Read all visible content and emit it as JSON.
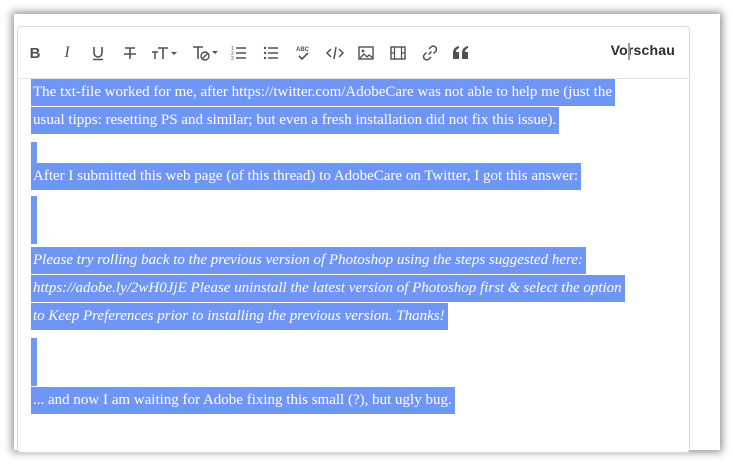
{
  "toolbar": {
    "buttons": [
      {
        "name": "bold-button",
        "icon": "bold-icon"
      },
      {
        "name": "italic-button",
        "icon": "italic-icon"
      },
      {
        "name": "underline-button",
        "icon": "underline-icon"
      },
      {
        "name": "strikethrough-button",
        "icon": "strikethrough-icon"
      },
      {
        "name": "text-size-button",
        "icon": "text-size-icon"
      },
      {
        "name": "clear-format-button",
        "icon": "clear-format-icon"
      },
      {
        "name": "numbered-list-button",
        "icon": "numbered-list-icon"
      },
      {
        "name": "bulleted-list-button",
        "icon": "bulleted-list-icon"
      },
      {
        "name": "spellcheck-button",
        "icon": "spellcheck-icon"
      },
      {
        "name": "code-button",
        "icon": "code-icon"
      },
      {
        "name": "image-button",
        "icon": "image-icon"
      },
      {
        "name": "video-button",
        "icon": "video-icon"
      },
      {
        "name": "link-button",
        "icon": "link-icon"
      },
      {
        "name": "quote-button",
        "icon": "quote-icon"
      }
    ],
    "preview_label": "Vorschau"
  },
  "content": {
    "p1_line1": "The txt-file worked for me, after https://twitter.com/AdobeCare was not able to help me (just the",
    "p1_line2": "usual tipps: resetting PS and similar; but even a fresh installation did not fix this issue).",
    "p2": "After I submitted this web page (of this thread) to AdobeCare on Twitter, I got this answer:",
    "quote_line1": "Please try rolling back to the previous version of Photoshop using the steps suggested here:",
    "quote_line2": "https://adobe.ly/2wH0JjE Please uninstall the latest version of Photoshop first & select the option",
    "quote_line3": "to Keep Preferences prior to installing the previous version. Thanks!",
    "p3": "... and now I am waiting for Adobe fixing this small (?), but ugly bug."
  },
  "colors": {
    "selection": "#6f95f5",
    "text": "#ffffff",
    "icon": "#505050"
  }
}
